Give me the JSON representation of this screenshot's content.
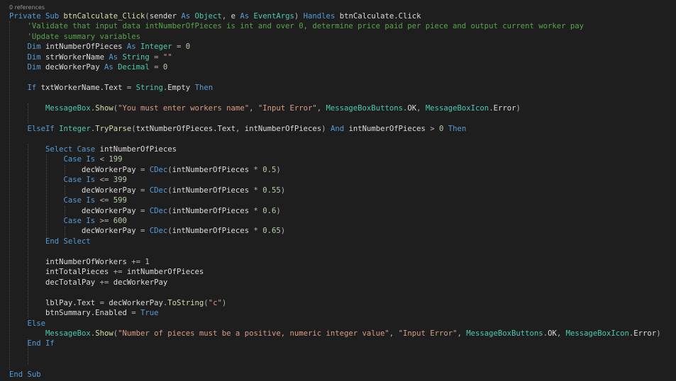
{
  "editor": {
    "codelens": "0 references",
    "colors": {
      "background": "#1e1e1e",
      "keyword": "#569cd6",
      "type": "#4ec9b0",
      "identifier": "#dcdcdc",
      "method": "#dcdcaa",
      "string": "#d69d85",
      "number": "#b5cea8",
      "comment": "#57a64a",
      "operator": "#b4b4b4",
      "codelens": "#999999"
    },
    "lines": [
      [
        [
          "kw",
          "Private Sub "
        ],
        [
          "fn",
          "btnCalculate_Click"
        ],
        [
          "op",
          "("
        ],
        [
          "id",
          "sender "
        ],
        [
          "kw",
          "As "
        ],
        [
          "type",
          "Object"
        ],
        [
          "op",
          ", "
        ],
        [
          "id",
          "e "
        ],
        [
          "kw",
          "As "
        ],
        [
          "type",
          "EventArgs"
        ],
        [
          "op",
          ") "
        ],
        [
          "kw",
          "Handles "
        ],
        [
          "id",
          "btnCalculate.Click"
        ]
      ],
      [
        [
          "cmt",
          "    'Validate that input data intNumberOfPieces is int and over 0, determine price paid per piece and output current worker pay"
        ]
      ],
      [
        [
          "cmt",
          "    'Update summary variables"
        ]
      ],
      [
        [
          "kw",
          "    Dim "
        ],
        [
          "id",
          "intNumberOfPieces "
        ],
        [
          "kw",
          "As "
        ],
        [
          "type",
          "Integer "
        ],
        [
          "op",
          "= "
        ],
        [
          "num",
          "0"
        ]
      ],
      [
        [
          "kw",
          "    Dim "
        ],
        [
          "id",
          "strWorkerName "
        ],
        [
          "kw",
          "As "
        ],
        [
          "type",
          "String "
        ],
        [
          "op",
          "= "
        ],
        [
          "str",
          "\"\""
        ]
      ],
      [
        [
          "kw",
          "    Dim "
        ],
        [
          "id",
          "decWorkerPay "
        ],
        [
          "kw",
          "As "
        ],
        [
          "type",
          "Decimal "
        ],
        [
          "op",
          "= "
        ],
        [
          "num",
          "0"
        ]
      ],
      [],
      [
        [
          "kw",
          "    If "
        ],
        [
          "id",
          "txtWorkerName.Text "
        ],
        [
          "op",
          "= "
        ],
        [
          "type",
          "String"
        ],
        [
          "op",
          "."
        ],
        [
          "id",
          "Empty "
        ],
        [
          "kw",
          "Then"
        ]
      ],
      [],
      [
        [
          "type",
          "        MessageBox"
        ],
        [
          "op",
          "."
        ],
        [
          "fn",
          "Show"
        ],
        [
          "op",
          "("
        ],
        [
          "str",
          "\"You must enter workers name\""
        ],
        [
          "op",
          ", "
        ],
        [
          "str",
          "\"Input Error\""
        ],
        [
          "op",
          ", "
        ],
        [
          "type",
          "MessageBoxButtons"
        ],
        [
          "op",
          "."
        ],
        [
          "id",
          "OK"
        ],
        [
          "op",
          ", "
        ],
        [
          "type",
          "MessageBoxIcon"
        ],
        [
          "op",
          "."
        ],
        [
          "id",
          "Error"
        ],
        [
          "op",
          ")"
        ]
      ],
      [],
      [
        [
          "kw",
          "    ElseIf "
        ],
        [
          "type",
          "Integer"
        ],
        [
          "op",
          "."
        ],
        [
          "fn",
          "TryParse"
        ],
        [
          "op",
          "("
        ],
        [
          "id",
          "txtNumberOfPieces.Text"
        ],
        [
          "op",
          ", "
        ],
        [
          "id",
          "intNumberOfPieces"
        ],
        [
          "op",
          ") "
        ],
        [
          "kw",
          "And "
        ],
        [
          "id",
          "intNumberOfPieces "
        ],
        [
          "op",
          "> "
        ],
        [
          "num",
          "0 "
        ],
        [
          "kw",
          "Then"
        ]
      ],
      [],
      [
        [
          "kw",
          "        Select Case "
        ],
        [
          "id",
          "intNumberOfPieces"
        ]
      ],
      [
        [
          "kw",
          "            Case Is "
        ],
        [
          "op",
          "< "
        ],
        [
          "num",
          "199"
        ]
      ],
      [
        [
          "id",
          "                decWorkerPay "
        ],
        [
          "op",
          "= "
        ],
        [
          "kw",
          "CDec"
        ],
        [
          "op",
          "("
        ],
        [
          "id",
          "intNumberOfPieces "
        ],
        [
          "op",
          "* "
        ],
        [
          "num",
          "0.5"
        ],
        [
          "op",
          ")"
        ]
      ],
      [
        [
          "kw",
          "            Case Is "
        ],
        [
          "op",
          "<= "
        ],
        [
          "num",
          "399"
        ]
      ],
      [
        [
          "id",
          "                decWorkerPay "
        ],
        [
          "op",
          "= "
        ],
        [
          "kw",
          "CDec"
        ],
        [
          "op",
          "("
        ],
        [
          "id",
          "intNumberOfPieces "
        ],
        [
          "op",
          "* "
        ],
        [
          "num",
          "0.55"
        ],
        [
          "op",
          ")"
        ]
      ],
      [
        [
          "kw",
          "            Case Is "
        ],
        [
          "op",
          "<= "
        ],
        [
          "num",
          "599"
        ]
      ],
      [
        [
          "id",
          "                decWorkerPay "
        ],
        [
          "op",
          "= "
        ],
        [
          "kw",
          "CDec"
        ],
        [
          "op",
          "("
        ],
        [
          "id",
          "intNumberOfPieces "
        ],
        [
          "op",
          "* "
        ],
        [
          "num",
          "0.6"
        ],
        [
          "op",
          ")"
        ]
      ],
      [
        [
          "kw",
          "            Case Is "
        ],
        [
          "op",
          ">= "
        ],
        [
          "num",
          "600"
        ]
      ],
      [
        [
          "id",
          "                decWorkerPay "
        ],
        [
          "op",
          "= "
        ],
        [
          "kw",
          "CDec"
        ],
        [
          "op",
          "("
        ],
        [
          "id",
          "intNumberOfPieces "
        ],
        [
          "op",
          "* "
        ],
        [
          "num",
          "0.65"
        ],
        [
          "op",
          ")"
        ]
      ],
      [
        [
          "kw",
          "        End Select"
        ]
      ],
      [],
      [
        [
          "id",
          "        intNumberOfWorkers "
        ],
        [
          "op",
          "+= "
        ],
        [
          "num",
          "1"
        ]
      ],
      [
        [
          "id",
          "        intTotalPieces "
        ],
        [
          "op",
          "+= "
        ],
        [
          "id",
          "intNumberOfPieces"
        ]
      ],
      [
        [
          "id",
          "        decTotalPay "
        ],
        [
          "op",
          "+= "
        ],
        [
          "id",
          "decWorkerPay"
        ]
      ],
      [],
      [
        [
          "id",
          "        lblPay.Text "
        ],
        [
          "op",
          "= "
        ],
        [
          "id",
          "decWorkerPay"
        ],
        [
          "op",
          "."
        ],
        [
          "fn",
          "ToString"
        ],
        [
          "op",
          "("
        ],
        [
          "str",
          "\"c\""
        ],
        [
          "op",
          ")"
        ]
      ],
      [
        [
          "id",
          "        btnSummary.Enabled "
        ],
        [
          "op",
          "= "
        ],
        [
          "kw",
          "True"
        ]
      ],
      [
        [
          "kw",
          "    Else"
        ]
      ],
      [
        [
          "type",
          "        MessageBox"
        ],
        [
          "op",
          "."
        ],
        [
          "fn",
          "Show"
        ],
        [
          "op",
          "("
        ],
        [
          "str",
          "\"Number of pieces must be a positive, numeric integer value\""
        ],
        [
          "op",
          ", "
        ],
        [
          "str",
          "\"Input Error\""
        ],
        [
          "op",
          ", "
        ],
        [
          "type",
          "MessageBoxButtons"
        ],
        [
          "op",
          "."
        ],
        [
          "id",
          "OK"
        ],
        [
          "op",
          ", "
        ],
        [
          "type",
          "MessageBoxIcon"
        ],
        [
          "op",
          "."
        ],
        [
          "id",
          "Error"
        ],
        [
          "op",
          ")"
        ]
      ],
      [
        [
          "kw",
          "    End If"
        ]
      ],
      [],
      [],
      [
        [
          "kw",
          "End Sub"
        ]
      ]
    ]
  }
}
